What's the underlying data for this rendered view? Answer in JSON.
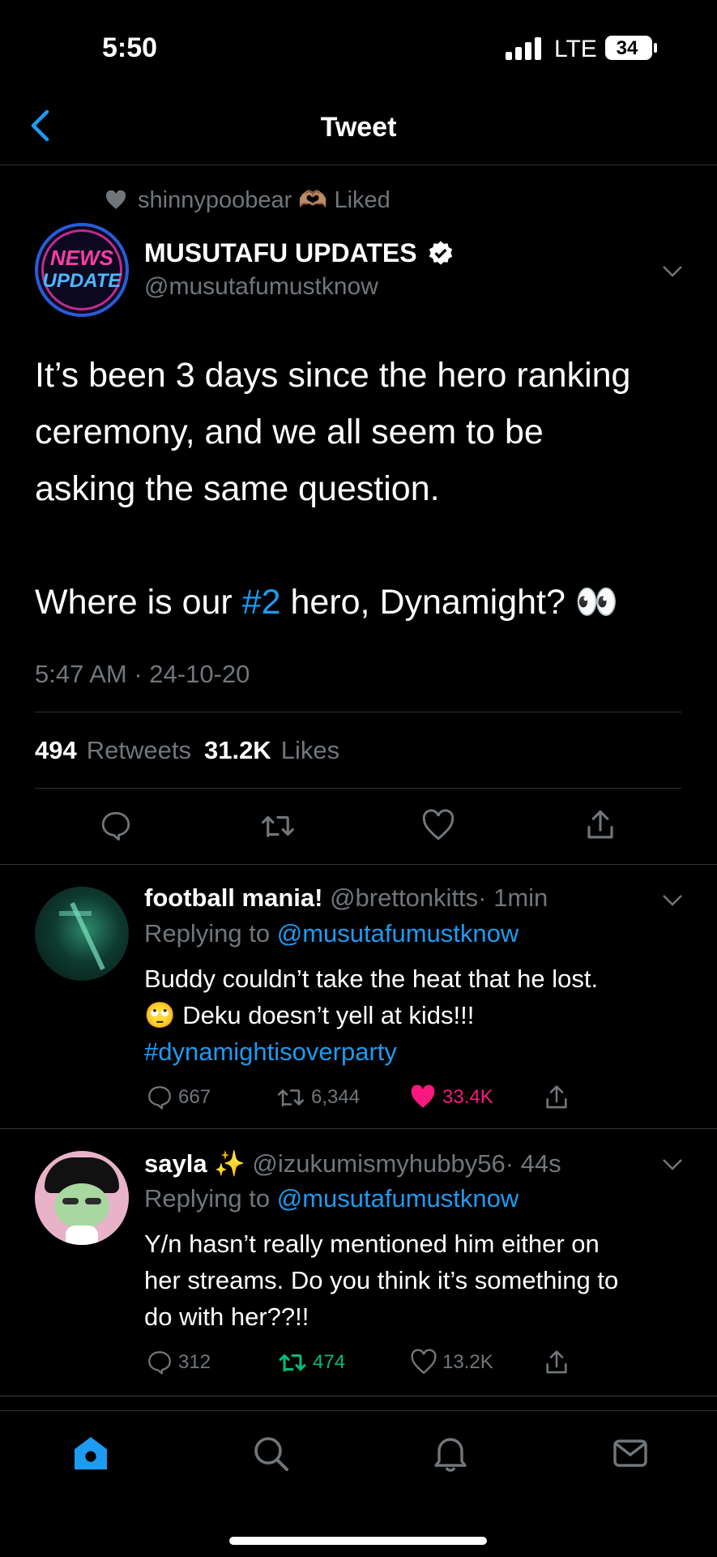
{
  "status": {
    "time": "5:50",
    "network": "LTE",
    "battery": "34"
  },
  "header": {
    "title": "Tweet"
  },
  "tweet": {
    "social_context": "shinnypoobear 🫶🏽 Liked",
    "avatar_text_1": "NEWS",
    "avatar_text_2": "UPDATE",
    "display_name": "MUSUTAFU UPDATES",
    "handle": "@musutafumustknow",
    "text_line_1": "It’s been 3 days since the hero ranking",
    "text_line_2": "ceremony, and we all seem to be",
    "text_line_3": "asking the same question.",
    "text_line_4_pre": "Where is our ",
    "text_line_4_hashtag": "#2",
    "text_line_4_post": " hero, Dynamight? 👀",
    "timestamp": "5:47 AM · 24-10-20",
    "retweets_count": "494",
    "retweets_label": "Retweets",
    "likes_count": "31.2K",
    "likes_label": "Likes"
  },
  "replies": [
    {
      "name": "football mania!",
      "handle": "@brettonkitts",
      "time": "· 1min",
      "replying_label": "Replying to",
      "replying_handle": "@musutafumustknow",
      "line_1": "Buddy couldn’t take the heat that he lost.",
      "line_2": "🙄 Deku doesn’t yell at kids!!!",
      "hashtag": "#dynamightisoverparty",
      "comments": "667",
      "retweets": "6,344",
      "likes": "33.4K"
    },
    {
      "name": "sayla ✨",
      "handle": "@izukumismyhubby56",
      "time": "· 44s",
      "replying_label": "Replying to",
      "replying_handle": "@musutafumustknow",
      "line_1": "Y/n hasn’t really mentioned him either on",
      "line_2": "her streams. Do you think it’s something to",
      "line_3": "do with her??!!",
      "comments": "312",
      "retweets": "474",
      "likes": "13.2K"
    }
  ],
  "colors": {
    "accent": "#1d9bf0",
    "like": "#f91880",
    "retweet": "#00ba7c",
    "muted": "#71767b"
  }
}
